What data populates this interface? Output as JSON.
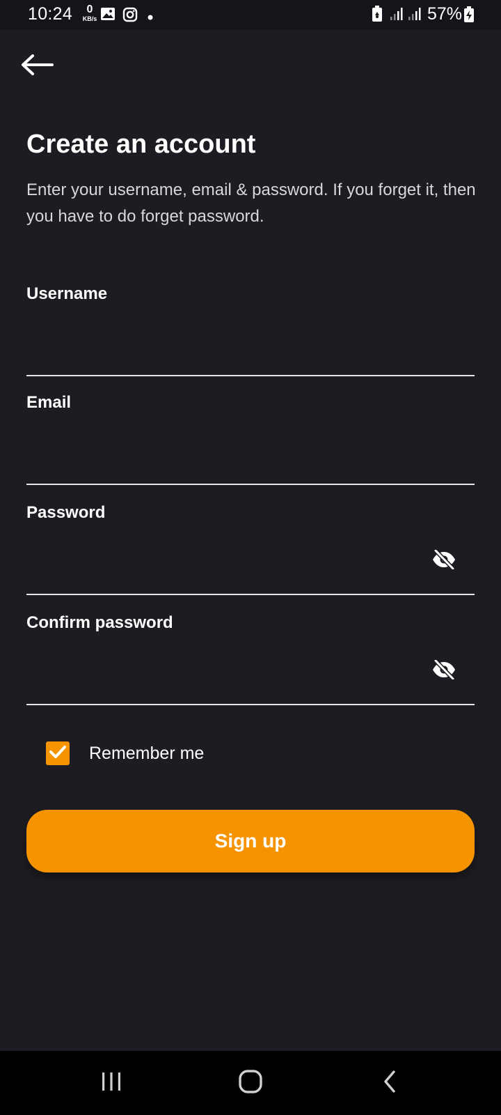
{
  "status_bar": {
    "time": "10:24",
    "net_speed_value": "0",
    "net_speed_unit": "KB/s",
    "battery_percent": "57%",
    "icons": [
      "image-icon",
      "instagram-icon",
      "dot-icon",
      "battery-saver-icon",
      "signal-icon",
      "signal-icon",
      "battery-charging-icon"
    ]
  },
  "header": {
    "back_icon": "arrow-left-icon"
  },
  "form": {
    "title": "Create an account",
    "subtitle": "Enter your username, email & password. If you forget it, then you have to do forget password.",
    "fields": [
      {
        "label": "Username",
        "value": ""
      },
      {
        "label": "Email",
        "value": ""
      },
      {
        "label": "Password",
        "value": "",
        "toggle_icon": "eye-off-icon"
      },
      {
        "label": "Confirm password",
        "value": "",
        "toggle_icon": "eye-off-icon"
      }
    ],
    "remember_label": "Remember me",
    "remember_checked": true,
    "submit_label": "Sign up"
  },
  "nav_bar": {
    "buttons": [
      "recent-apps-icon",
      "home-icon",
      "back-icon"
    ]
  },
  "colors": {
    "background": "#1c1c22",
    "accent": "#f59300",
    "text": "#ffffff",
    "subtext": "#d6d6dc",
    "underline": "#e8e8ec"
  }
}
